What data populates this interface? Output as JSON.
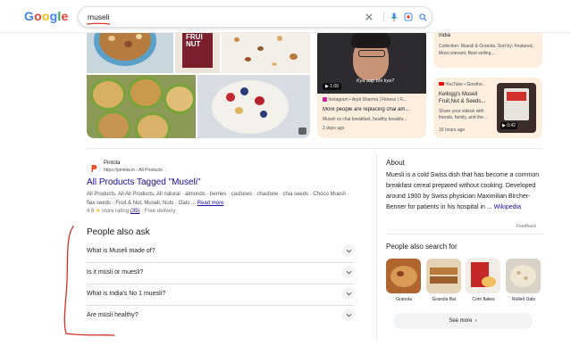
{
  "header": {
    "logo": {
      "l1": "G",
      "l2": "o",
      "l3": "o",
      "l4": "g",
      "l5": "l",
      "l6": "e"
    },
    "search": {
      "query": "museli"
    }
  },
  "video_card": {
    "duration": "▶ 1:00",
    "overlay_text": "Kya aap bhi kya?",
    "source": "Instagram • Arpit Sharma | Fitness | Fi...",
    "title": "More people are replacing chai am...",
    "description": "Museli vs chai breakfast, healthy breakfa...",
    "date": "2 days ago"
  },
  "right_card_top": {
    "title": "India",
    "desc": "Collection: Muesli & Granola. Sort by: Featured, Most relevant, Best selling,..."
  },
  "yt_card": {
    "source": "YouTube • Gowthe...",
    "title": "Kellogg's Museli Fruit,Nut & Seeds...",
    "description": "Share your videos with friends, family, and the...",
    "age": "16 hours ago",
    "duration": "▶ 0:42"
  },
  "result": {
    "site": "Pintola",
    "url": "https://pintola.in › All Products",
    "title": "All Products Tagged \"Museli\"",
    "snippet": "All Products. All All Products, All natural · almonds · berries · cashews · chashew · chia seeds · Choco Muesli · flax seeds · Fruit & Nut, Museli, Nuts · Oats ...",
    "read_more": "Read more",
    "rating": "4.6",
    "rating_text": "store rating",
    "rating_count": "(35)",
    "delivery": "· Free delivery"
  },
  "paa": {
    "title": "People also ask",
    "questions": [
      "What is Museli made of?",
      "Is it müsli or muesli?",
      "What is India's No 1 muesli?",
      "Are müsli healthy?"
    ]
  },
  "about": {
    "title": "About",
    "text": "Muesli is a cold Swiss dish that has become a common breakfast cereal prepared without cooking. Developed around 1900 by Swiss physician Maximilian Bircher-Benner for patients in his hospital in ...",
    "link": "Wikipedia",
    "feedback": "Feedback"
  },
  "people_also_search": {
    "title": "People also search for",
    "items": [
      "Granola",
      "Granola Bar",
      "Corn flakes",
      "Rolled Oats"
    ],
    "see_more": "See more"
  },
  "colors": {
    "link": "#1a0dab",
    "card_bg": "#fdeedd",
    "annotation": "#d93025"
  }
}
